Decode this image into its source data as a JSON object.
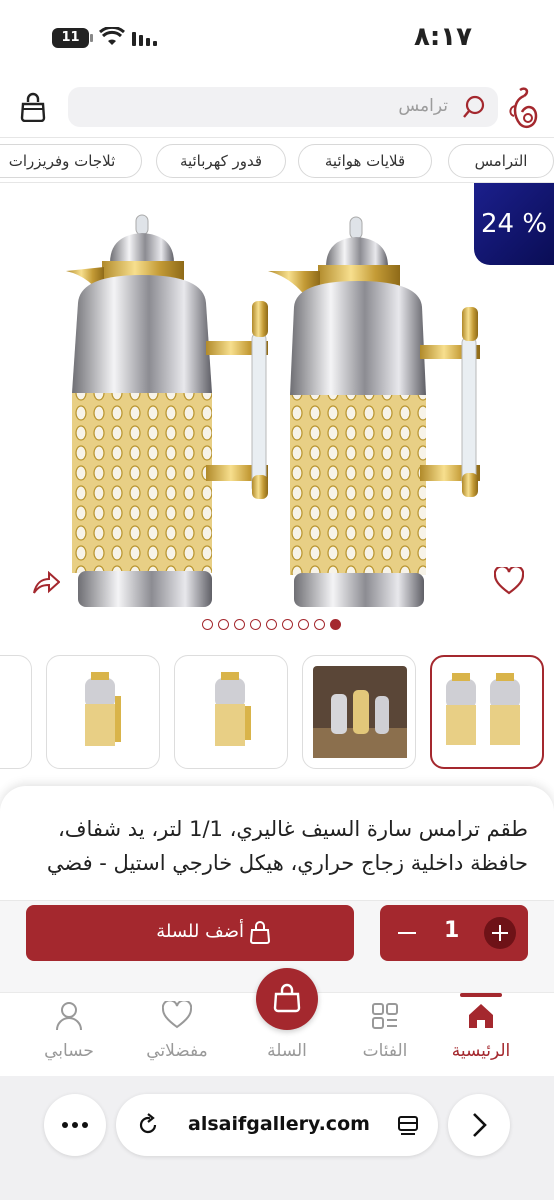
{
  "status_bar": {
    "time": "٨:١٧",
    "battery": "11"
  },
  "header": {
    "search_placeholder": "ترامس"
  },
  "categories": [
    "الترامس",
    "قلايات هوائية",
    "قدور كهربائية",
    "ثلاجات وفريزرات"
  ],
  "product": {
    "discount_badge": "24 %",
    "title": "طقم ترامس سارة السيف غاليري، 1/1 لتر، يد شفاف، حافظة داخلية زجاج حراري، هيكل خارجي استيل - فضي",
    "image_count": 9,
    "active_image": 1
  },
  "actions": {
    "add_to_cart": "أضف للسلة",
    "quantity": "1"
  },
  "bottom_nav": {
    "home": "الرئيسية",
    "categories": "الفئات",
    "cart": "السلة",
    "favorites": "مفضلاتي",
    "account": "حسابي"
  },
  "browser": {
    "url": "alsaifgallery.com"
  },
  "colors": {
    "brand": "#a4282e",
    "badge": "#1b1f8c"
  }
}
